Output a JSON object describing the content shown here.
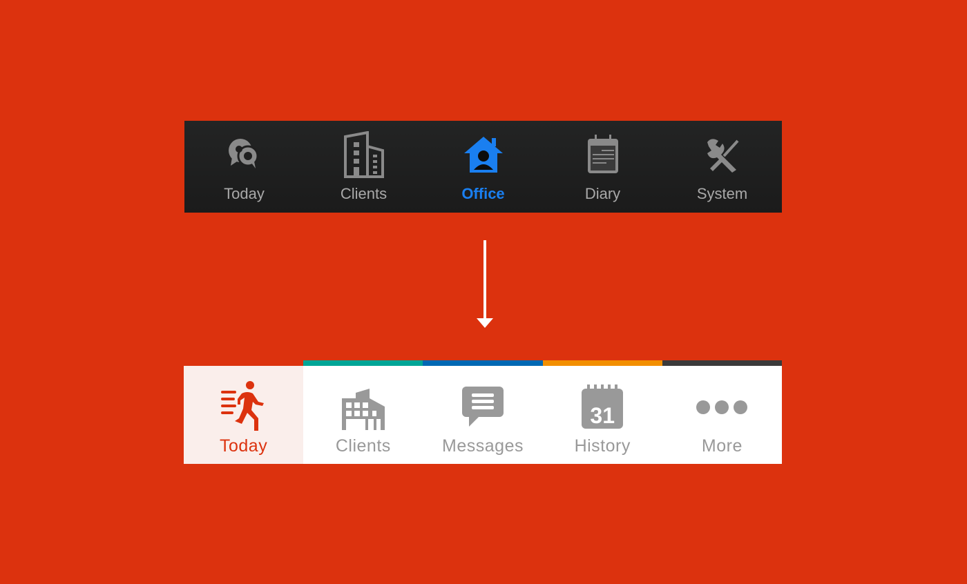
{
  "colors": {
    "background": "#dc320e",
    "old_bar_bg": "#1e1f1f",
    "old_inactive": "#a9a9a9",
    "old_active": "#1a7ff0",
    "new_inactive": "#999999",
    "new_active": "#dc320e",
    "new_active_bg": "#faeeeb"
  },
  "old_tabbar": {
    "tabs": [
      {
        "label": "Today",
        "icon": "chat-bubbles-icon",
        "active": false
      },
      {
        "label": "Clients",
        "icon": "building-icon",
        "active": false
      },
      {
        "label": "Office",
        "icon": "home-person-icon",
        "active": true
      },
      {
        "label": "Diary",
        "icon": "calendar-icon",
        "active": false
      },
      {
        "label": "System",
        "icon": "tools-icon",
        "active": false
      }
    ]
  },
  "arrow": {
    "icon": "arrow-down-icon"
  },
  "new_tabbar": {
    "tabs": [
      {
        "label": "Today",
        "icon": "running-person-icon",
        "active": true,
        "stripe": "#dc320e"
      },
      {
        "label": "Clients",
        "icon": "building-icon",
        "active": false,
        "stripe": "#00a596"
      },
      {
        "label": "Messages",
        "icon": "message-icon",
        "active": false,
        "stripe": "#0068b3"
      },
      {
        "label": "History",
        "icon": "calendar-icon",
        "active": false,
        "stripe": "#f28f00",
        "badge": "31"
      },
      {
        "label": "More",
        "icon": "more-dots-icon",
        "active": false,
        "stripe": "#3a3a3a"
      }
    ]
  }
}
